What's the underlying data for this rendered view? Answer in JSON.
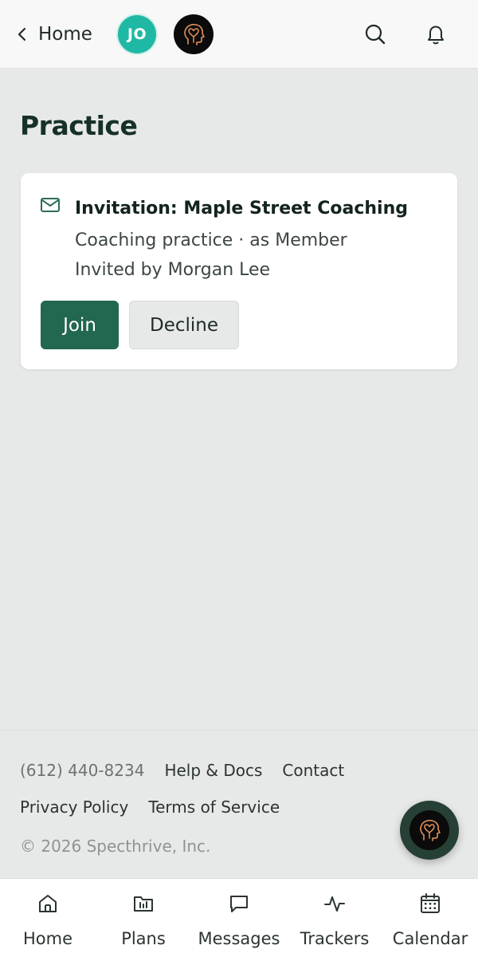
{
  "header": {
    "back_label": "Home",
    "avatar_initials": "JO",
    "accent_color": "#1fb8a4"
  },
  "main": {
    "title": "Practice",
    "invitation": {
      "title": "Invitation: Maple Street Coaching",
      "detail": "Coaching practice · as Member",
      "invited_by": "Invited by Morgan Lee",
      "join_label": "Join",
      "decline_label": "Decline",
      "join_color": "#22674f"
    }
  },
  "footer": {
    "phone": "(612) 440-8234",
    "help_label": "Help & Docs",
    "contact_label": "Contact",
    "privacy_label": "Privacy Policy",
    "terms_label": "Terms of Service",
    "copyright": "© 2026 Specthrive, Inc."
  },
  "bottom_nav": {
    "items": [
      {
        "label": "Home",
        "icon": "home-icon"
      },
      {
        "label": "Plans",
        "icon": "folder-icon"
      },
      {
        "label": "Messages",
        "icon": "chat-icon"
      },
      {
        "label": "Trackers",
        "icon": "activity-icon"
      },
      {
        "label": "Calendar",
        "icon": "calendar-icon"
      }
    ]
  }
}
